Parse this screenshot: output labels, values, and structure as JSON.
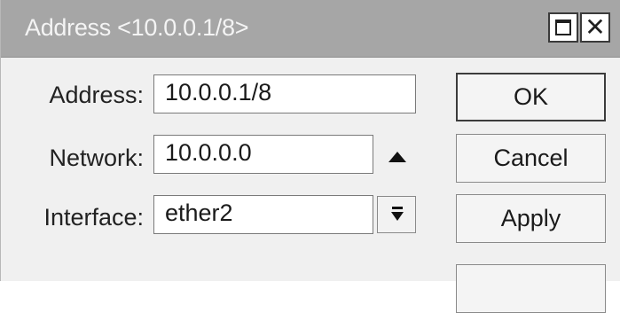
{
  "window": {
    "title": "Address <10.0.0.1/8>",
    "maximize_icon": "maximize-icon",
    "close_icon": "close-icon",
    "close_glyph": "✕"
  },
  "form": {
    "address": {
      "label": "Address:",
      "value": "10.0.0.1/8"
    },
    "network": {
      "label": "Network:",
      "value": "10.0.0.0"
    },
    "interface": {
      "label": "Interface:",
      "value": "ether2"
    }
  },
  "buttons": {
    "ok": "OK",
    "cancel": "Cancel",
    "apply": "Apply"
  },
  "colors": {
    "titlebar": "#a6a6a6",
    "background": "#f0f0f0"
  }
}
